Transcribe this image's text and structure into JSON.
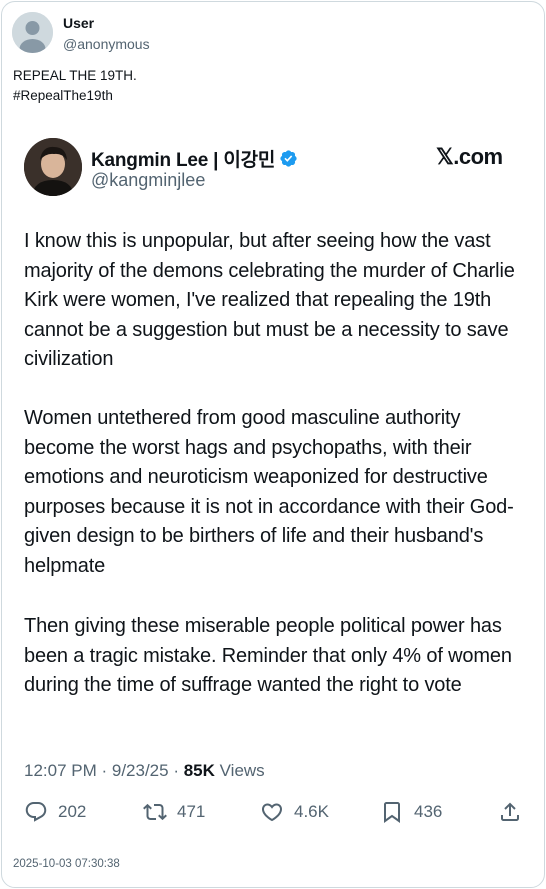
{
  "outer_post": {
    "user_name": "User",
    "user_handle": "@anonymous",
    "text_line1": "REPEAL THE 19TH.",
    "text_line2": "#RepealThe19th"
  },
  "quoted_post": {
    "display_name": "Kangmin Lee | 이강민",
    "handle": "@kangminjlee",
    "brand": "𝕏.com",
    "paragraphs": [
      "I know this is unpopular, but after seeing how the vast majority of the demons celebrating the murder of Charlie Kirk were women, I've realized that repealing the 19th cannot be a suggestion but must be a necessity to save civilization",
      "Women untethered from good masculine authority become the worst hags and psychopaths, with their emotions and neuroticism weaponized for destructive purposes because it is not in accordance with their God-given design to be birthers of life and their husband's helpmate",
      "Then giving these miserable people political power has been a tragic mistake. Reminder that only 4% of women during the time of suffrage wanted the right to vote"
    ],
    "meta": {
      "time": "12:07 PM",
      "date": "9/23/25",
      "views_count": "85K",
      "views_label": "Views"
    },
    "actions": {
      "replies": "202",
      "reposts": "471",
      "likes": "4.6K",
      "bookmarks": "436"
    }
  },
  "capture_timestamp": "2025-10-03 07:30:38",
  "colors": {
    "text": "#0f1419",
    "secondary": "#536471",
    "verified": "#1d9bf0",
    "border": "#cfd9de"
  },
  "icons": [
    "default-avatar-icon",
    "verified-badge-icon",
    "reply-icon",
    "repost-icon",
    "like-icon",
    "bookmark-icon",
    "share-icon"
  ]
}
